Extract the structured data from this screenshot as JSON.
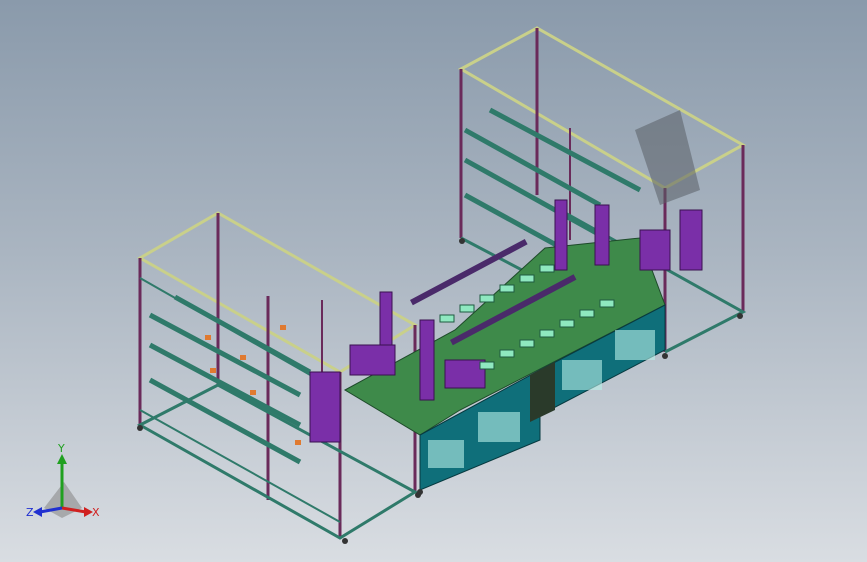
{
  "view": {
    "background_top": "#8a9aab",
    "background_bottom": "#d9dde2"
  },
  "triad": {
    "x_label": "X",
    "y_label": "Y",
    "z_label": "Z",
    "x_color": "#d02020",
    "y_color": "#20a020",
    "z_color": "#2030d0"
  },
  "model": {
    "frame_color": "#2f7a6a",
    "frame_highlight": "#c9d08a",
    "post_color": "#6a2a5a",
    "table_color": "#3e8a4a",
    "cabinet_color": "#0f6f7a",
    "cylinder_color": "#7a2fa8",
    "pad_color": "#8fe8c0",
    "accent_color": "#e07a30"
  }
}
